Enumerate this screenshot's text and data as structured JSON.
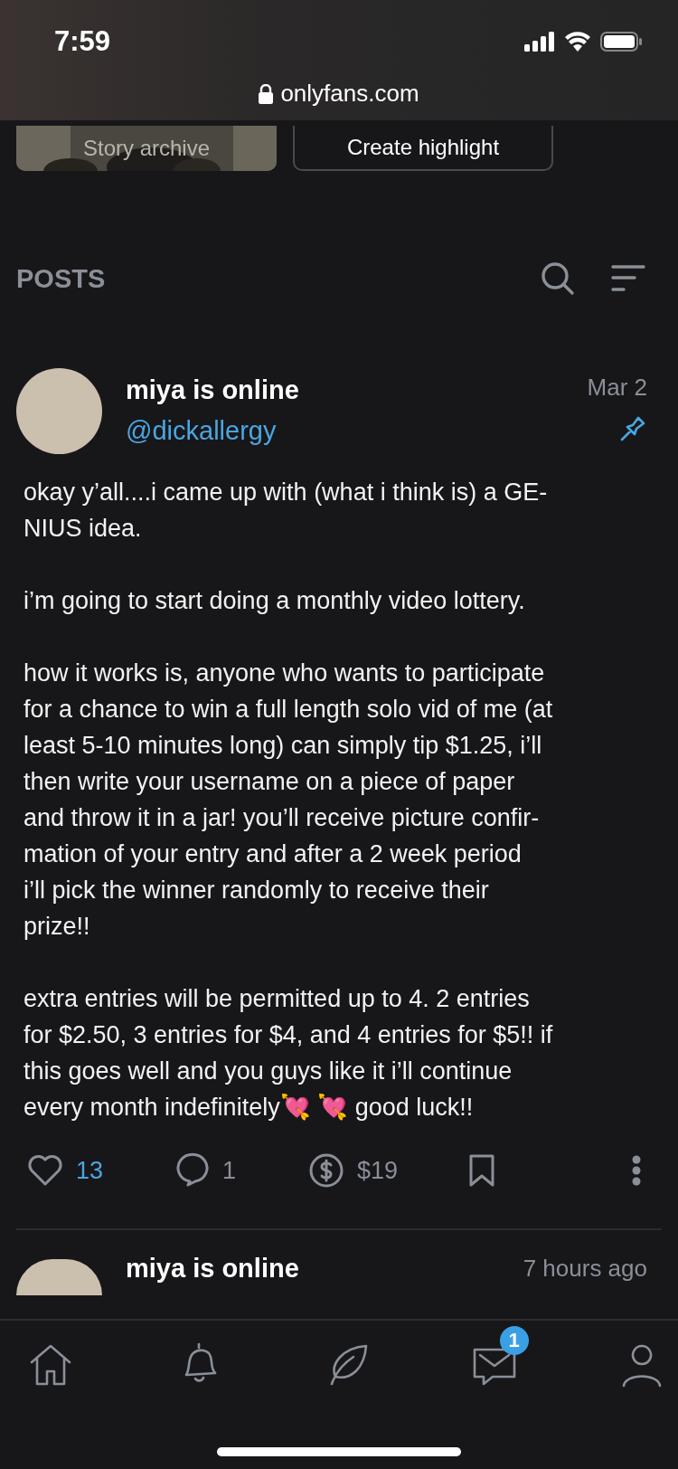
{
  "status_bar": {
    "time": "7:59"
  },
  "address_bar": {
    "url": "onlyfans.com"
  },
  "highlights": [
    {
      "kind": "picture",
      "label": "Story archive"
    },
    {
      "kind": "button",
      "label": "Create highlight"
    }
  ],
  "section": {
    "title": "POSTS"
  },
  "post": {
    "author": "miya is online",
    "handle": "@dickallergy",
    "time": "Mar 2",
    "pinned": true,
    "paragraphs": [
      "okay y’all....i came up with (what i think is) a GE-\nNIUS idea.",
      "i’m going to start doing a monthly video lottery.",
      "how it works is, anyone who wants to participate\nfor a chance to win a full length solo vid of me (at\nleast 5-10 minutes long) can simply tip $1.25, i’ll\nthen write your username on a piece of paper\nand throw it in a jar! you’ll receive picture confir-\nmation of your entry and after a 2 week period\ni’ll pick the winner randomly to receive their\nprize!!",
      "extra entries will be permitted up to 4. 2 entries\nfor $2.50, 3 entries for $4, and 4 entries for $5!! if\nthis goes well and you guys like it i’ll continue\nevery month indefinitely💘 💘 good luck!!"
    ],
    "likes": "13",
    "comments": "1",
    "tips": "$19"
  },
  "next_post": {
    "author": "miya is online",
    "time": "7 hours ago"
  },
  "tab_bar": {
    "items": [
      {
        "kind": "home"
      },
      {
        "kind": "bell"
      },
      {
        "kind": "leaf"
      },
      {
        "kind": "messages",
        "badge": "1"
      },
      {
        "kind": "profile"
      }
    ]
  }
}
